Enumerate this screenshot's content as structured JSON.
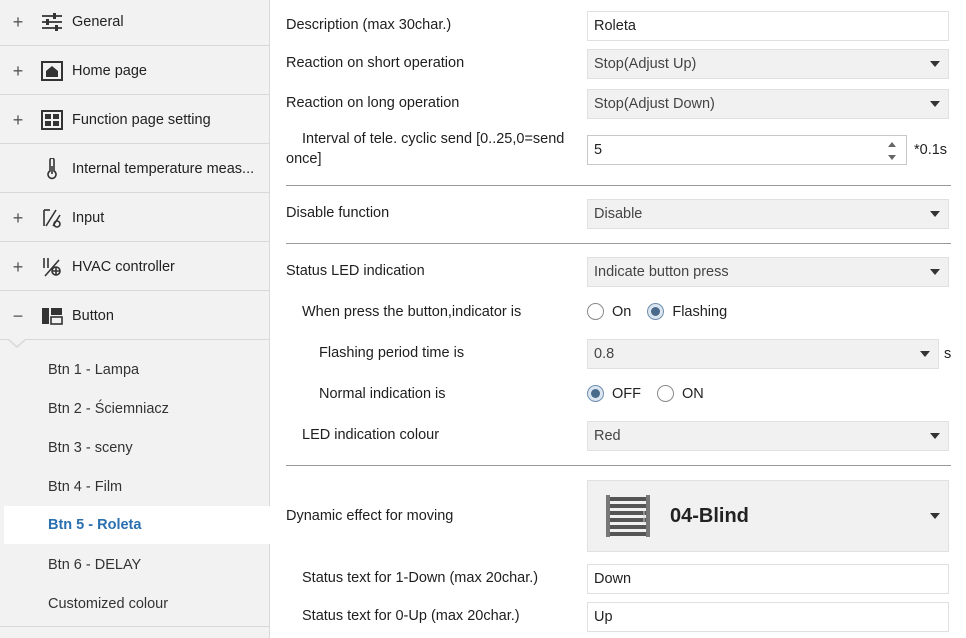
{
  "sidebar": {
    "items": [
      {
        "expander": "+",
        "icon": "sliders-icon",
        "label": "General"
      },
      {
        "expander": "+",
        "icon": "home-icon",
        "label": "Home page"
      },
      {
        "expander": "+",
        "icon": "grid-icon",
        "label": "Function page setting"
      },
      {
        "expander": "",
        "icon": "thermometer-icon",
        "label": "Internal temperature meas..."
      },
      {
        "expander": "+",
        "icon": "input-icon",
        "label": "Input"
      },
      {
        "expander": "+",
        "icon": "hvac-icon",
        "label": "HVAC controller"
      },
      {
        "expander": "−",
        "icon": "button-panel-icon",
        "label": "Button"
      }
    ],
    "sub_items": [
      {
        "label": "Btn 1 - Lampa"
      },
      {
        "label": "Btn 2 - Ściemniacz"
      },
      {
        "label": "Btn 3 - sceny"
      },
      {
        "label": "Btn 4 - Film"
      },
      {
        "label": "Btn 5 - Roleta"
      },
      {
        "label": "Btn 6 - DELAY"
      },
      {
        "label": "Customized colour"
      }
    ],
    "active_sub": "Btn 5 - Roleta"
  },
  "form": {
    "description": {
      "label": "Description (max 30char.)",
      "value": "Roleta"
    },
    "short_op": {
      "label": "Reaction on short operation",
      "value": "Stop(Adjust Up)"
    },
    "long_op": {
      "label": "Reaction on long operation",
      "value": "Stop(Adjust Down)"
    },
    "interval": {
      "label_line1": "Interval of tele. cyclic send [0..25,0=send",
      "label_line2": "once]",
      "value": "5",
      "unit": "*0.1s"
    },
    "disable_function": {
      "label": "Disable function",
      "value": "Disable"
    },
    "status_led": {
      "label": "Status LED indication",
      "value": "Indicate button press"
    },
    "press_indicator": {
      "label": "When press the button,indicator is",
      "options": [
        "On",
        "Flashing"
      ],
      "selected": "Flashing"
    },
    "flashing_period": {
      "label": "Flashing period time is",
      "value": "0.8",
      "unit": "s"
    },
    "normal_indication": {
      "label": "Normal indication is",
      "options": [
        "OFF",
        "ON"
      ],
      "selected": "OFF"
    },
    "led_colour": {
      "label": "LED indication colour",
      "value": "Red"
    },
    "dynamic_effect": {
      "label": "Dynamic effect for moving",
      "value": "04-Blind",
      "icon": "blind-icon"
    },
    "status_down": {
      "label": "Status text for 1-Down (max 20char.)",
      "value": "Down"
    },
    "status_up": {
      "label": "Status text for 0-Up (max 20char.)",
      "value": "Up"
    }
  },
  "colors": {
    "accent": "#2a6fb0",
    "sidebar_bg": "#f2f2f2",
    "select_bg": "#f1f1f1"
  }
}
